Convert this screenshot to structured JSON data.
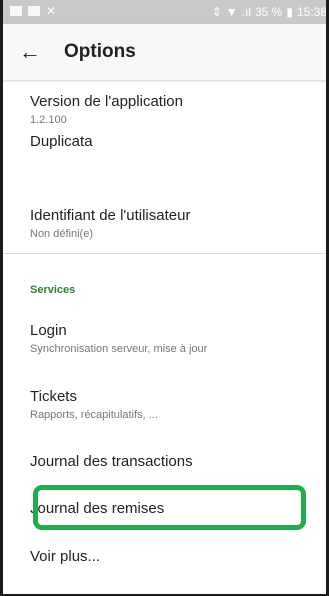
{
  "status_bar": {
    "time": "15:38",
    "battery": "35 %"
  },
  "app_bar": {
    "back_icon": "arrow-back-icon",
    "title": "Options"
  },
  "items": [
    {
      "title": "Version de l'application",
      "subtitle": "1.2.100"
    },
    {
      "title": "Duplicata",
      "subtitle": ""
    },
    {
      "title": "Identifiant de l'utilisateur",
      "subtitle": "Non défini(e)"
    }
  ],
  "services": {
    "header": "Services",
    "items": [
      {
        "title": "Login",
        "subtitle": "Synchronisation serveur, mise à jour"
      },
      {
        "title": "Tickets",
        "subtitle": "Rapports, récapitulatifs, ..."
      },
      {
        "title": "Journal des transactions",
        "subtitle": ""
      },
      {
        "title": "Journal des remises",
        "subtitle": ""
      },
      {
        "title": "Voir plus...",
        "subtitle": ""
      }
    ]
  },
  "colors": {
    "section_header": "#2e7d32",
    "highlight": "#1fae4b"
  }
}
